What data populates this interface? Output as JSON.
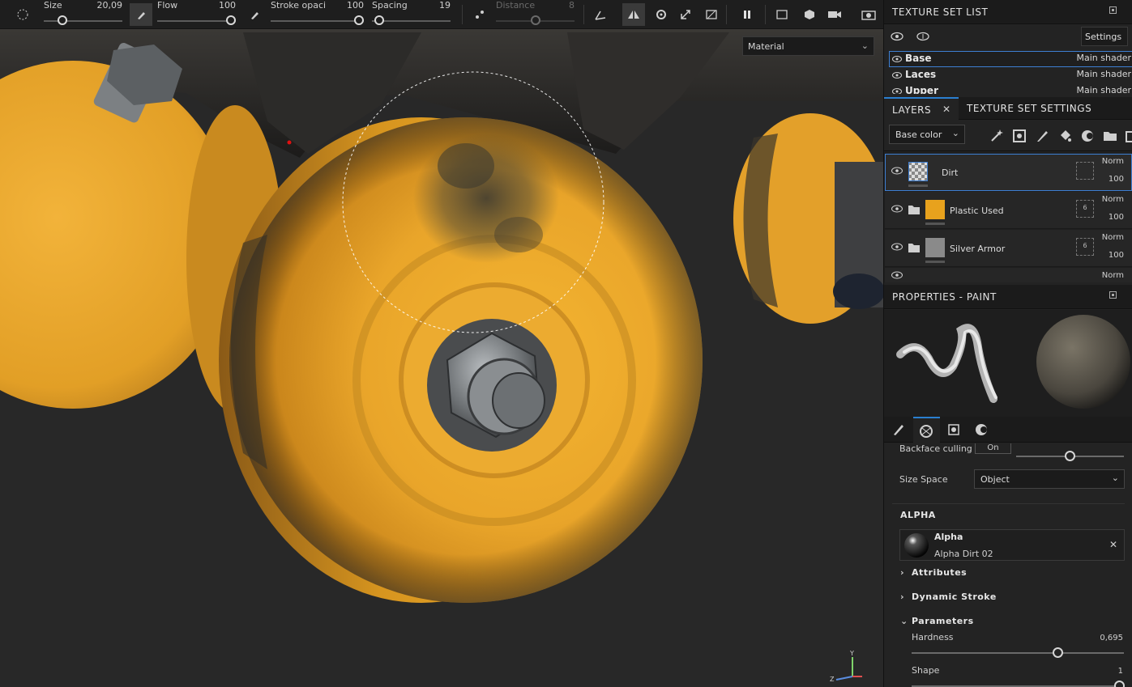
{
  "toolbar": {
    "size": {
      "label": "Size",
      "value": "20,09",
      "level": 0.2
    },
    "flow": {
      "label": "Flow",
      "value": "100",
      "level": 1.0
    },
    "stroke_opacity": {
      "label": "Stroke opaci",
      "value": "100",
      "level": 1.0
    },
    "spacing": {
      "label": "Spacing",
      "value": "19",
      "level": 0.04
    },
    "distance": {
      "label": "Distance",
      "value": "8",
      "level": 0.5,
      "disabled": true
    },
    "icons": [
      "brush-shape-icon",
      "paint-tool-icon",
      "stroke-tool-icon",
      "distance-icon",
      "lazy-mouse-icon",
      "symmetry-icon",
      "projection-icon",
      "transform-icon",
      "hide-icon",
      "pause-icon",
      "view-mode-icon",
      "3d-view-icon",
      "camera-icon",
      "screenshot-icon"
    ]
  },
  "viewport": {
    "material_mode": "Material",
    "axis": {
      "x": "X",
      "y": "Y",
      "z": "Z"
    }
  },
  "texture_set_list": {
    "title": "TEXTURE SET LIST",
    "settings_label": "Settings",
    "items": [
      {
        "name": "Base",
        "shader": "Main shader",
        "selected": true
      },
      {
        "name": "Laces",
        "shader": "Main shader",
        "selected": false
      },
      {
        "name": "Upper",
        "shader": "Main shader",
        "selected": false
      }
    ]
  },
  "layers": {
    "tab_label": "LAYERS",
    "tab2_label": "TEXTURE SET SETTINGS",
    "channel": "Base color",
    "items": [
      {
        "name": "Dirt",
        "blend": "Norm",
        "opacity": "100",
        "type": "paint",
        "selected": true,
        "thumb_color": "#ffffff"
      },
      {
        "name": "Plastic Used",
        "blend": "Norm",
        "opacity": "100",
        "type": "folder",
        "selected": false,
        "count": "6",
        "thumb_color": "#e8a21d"
      },
      {
        "name": "Silver Armor",
        "blend": "Norm",
        "opacity": "100",
        "type": "folder",
        "selected": false,
        "count": "6",
        "thumb_color": "#8a8a8a"
      },
      {
        "name": "",
        "blend": "Norm",
        "opacity": "",
        "type": "folder",
        "selected": false
      }
    ]
  },
  "properties": {
    "title": "PROPERTIES - PAINT",
    "backface_culling": {
      "label": "Backface culling",
      "value": "On"
    },
    "size_space": {
      "label": "Size Space",
      "value": "Object"
    },
    "alpha_section": "ALPHA",
    "alpha": {
      "title": "Alpha",
      "name": "Alpha Dirt 02"
    },
    "attributes": "Attributes",
    "dynamic_stroke": "Dynamic Stroke",
    "parameters": "Parameters",
    "hardness": {
      "label": "Hardness",
      "value": "0,695",
      "level": 0.695
    },
    "shape": {
      "label": "Shape",
      "value": "1",
      "level": 1.0
    }
  },
  "colors": {
    "accent": "#2a7fd0",
    "wheel": "#e8a21d",
    "panel_bg": "#232323",
    "viewport_bg": "#282828"
  }
}
